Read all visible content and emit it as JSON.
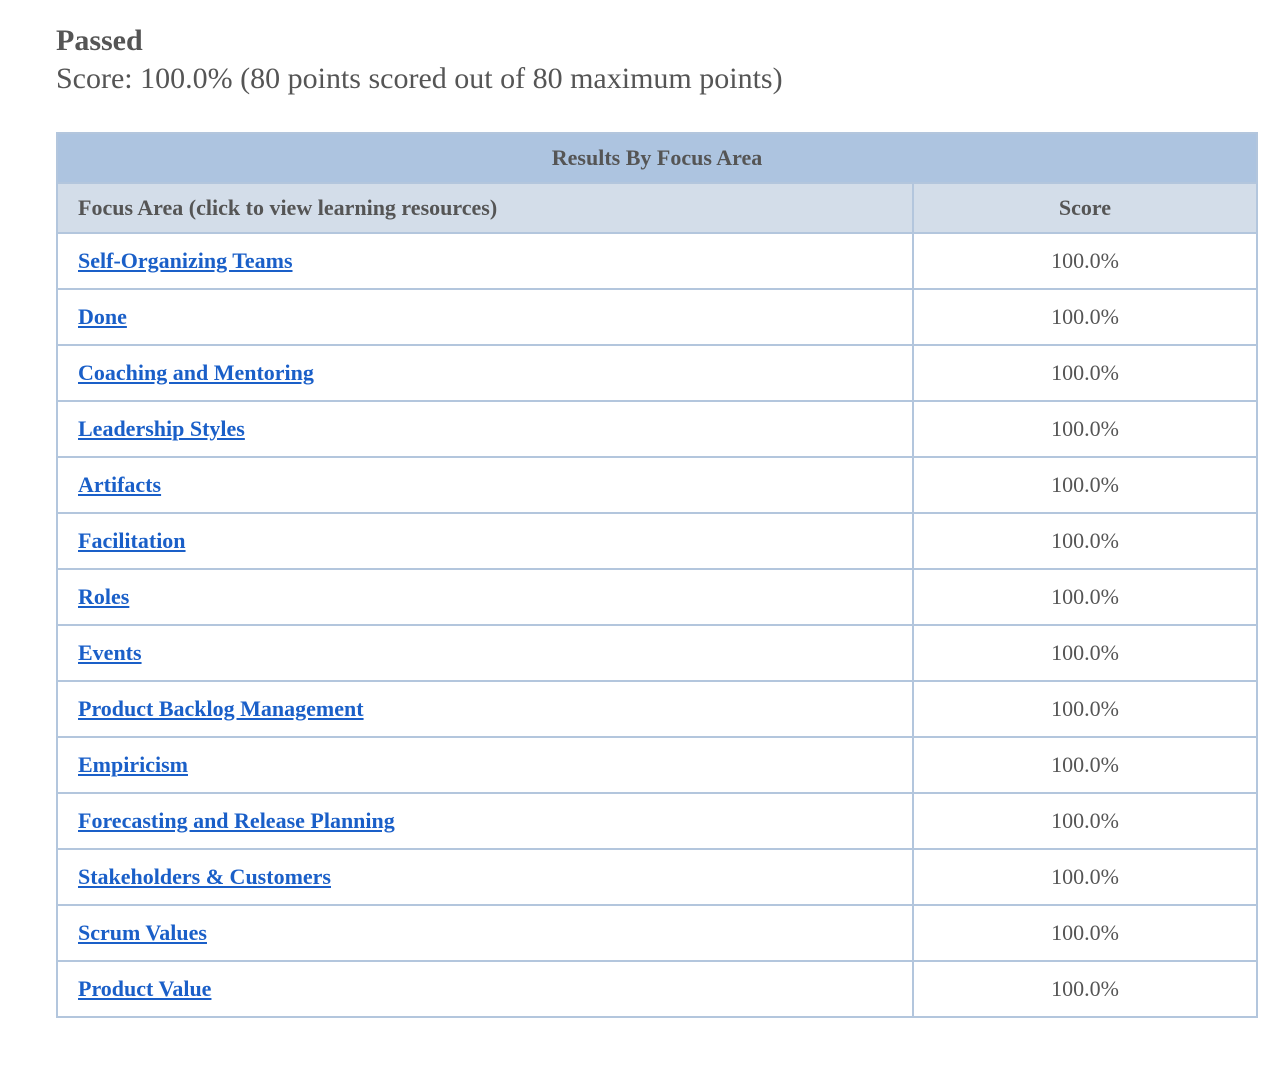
{
  "result": {
    "status": "Passed",
    "score_line": "Score: 100.0% (80 points scored out of 80 maximum points)"
  },
  "table": {
    "caption": "Results By Focus Area",
    "col_area": "Focus Area (click to view learning resources)",
    "col_score": "Score",
    "rows": [
      {
        "area": "Self-Organizing Teams",
        "score": "100.0%"
      },
      {
        "area": "Done",
        "score": "100.0%"
      },
      {
        "area": "Coaching and Mentoring",
        "score": "100.0%"
      },
      {
        "area": "Leadership Styles",
        "score": "100.0%"
      },
      {
        "area": "Artifacts",
        "score": "100.0%"
      },
      {
        "area": "Facilitation",
        "score": "100.0%"
      },
      {
        "area": "Roles",
        "score": "100.0%"
      },
      {
        "area": "Events",
        "score": "100.0%"
      },
      {
        "area": "Product Backlog Management",
        "score": "100.0%"
      },
      {
        "area": "Empiricism",
        "score": "100.0%"
      },
      {
        "area": "Forecasting and Release Planning",
        "score": "100.0%"
      },
      {
        "area": "Stakeholders & Customers",
        "score": "100.0%"
      },
      {
        "area": "Scrum Values",
        "score": "100.0%"
      },
      {
        "area": "Product Value",
        "score": "100.0%"
      }
    ]
  },
  "colors": {
    "link": "#1a5fc8",
    "caption_bg": "#adc4e0",
    "header_bg": "#d3dde9",
    "border": "#b3c6dd",
    "text": "#555555"
  }
}
